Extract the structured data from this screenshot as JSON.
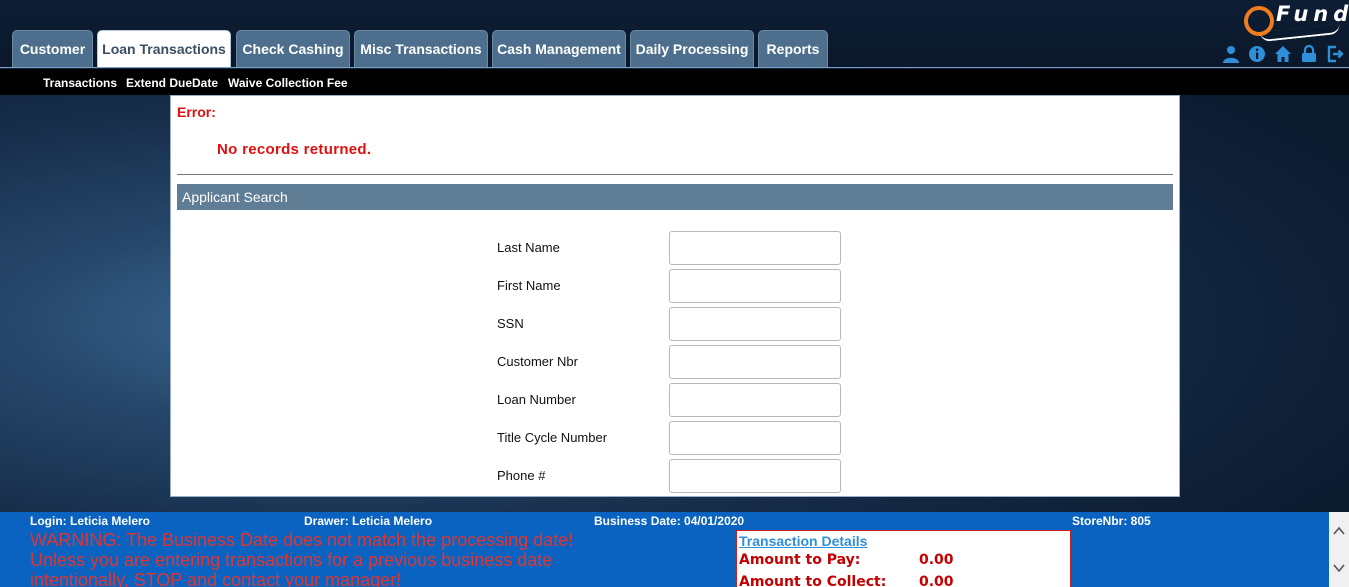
{
  "logo": {
    "text": "Fund"
  },
  "tabs": [
    {
      "label": "Customer",
      "active": false
    },
    {
      "label": "Loan Transactions",
      "active": true
    },
    {
      "label": "Check Cashing",
      "active": false
    },
    {
      "label": "Misc Transactions",
      "active": false
    },
    {
      "label": "Cash Management",
      "active": false
    },
    {
      "label": "Daily Processing",
      "active": false
    },
    {
      "label": "Reports",
      "active": false
    }
  ],
  "header_icons": [
    "user-icon",
    "info-icon",
    "home-icon",
    "lock-icon",
    "logout-icon"
  ],
  "submenu": [
    {
      "label": "Transactions"
    },
    {
      "label": "Extend DueDate"
    },
    {
      "label": "Waive Collection Fee"
    }
  ],
  "error": {
    "label": "Error:",
    "message": "No records returned."
  },
  "search": {
    "section_title": "Applicant Search",
    "fields": [
      {
        "label": "Last Name",
        "value": ""
      },
      {
        "label": "First Name",
        "value": ""
      },
      {
        "label": "SSN",
        "value": ""
      },
      {
        "label": "Customer Nbr",
        "value": ""
      },
      {
        "label": "Loan Number",
        "value": ""
      },
      {
        "label": "Title Cycle Number",
        "value": ""
      },
      {
        "label": "Phone #",
        "value": ""
      }
    ]
  },
  "footer": {
    "login": "Login: Leticia Melero",
    "drawer": "Drawer: Leticia Melero",
    "business_date": "Business Date: 04/01/2020",
    "store": "StoreNbr: 805",
    "warning": "WARNING: The Business Date does not match the processing date! Unless you are entering transactions for a previous business date intentionally, STOP and contact your manager!",
    "transaction_details": {
      "title": "Transaction Details",
      "rows": [
        {
          "label": "Amount to Pay:",
          "value": "0.00"
        },
        {
          "label": "Amount to Collect:",
          "value": "0.00"
        }
      ]
    }
  },
  "colors": {
    "accent_orange": "#f07c1c",
    "error_red": "#e01010",
    "section_bar": "#5f7d95",
    "footer_blue": "#0a63c0",
    "icon_blue": "#2f8fd8"
  }
}
